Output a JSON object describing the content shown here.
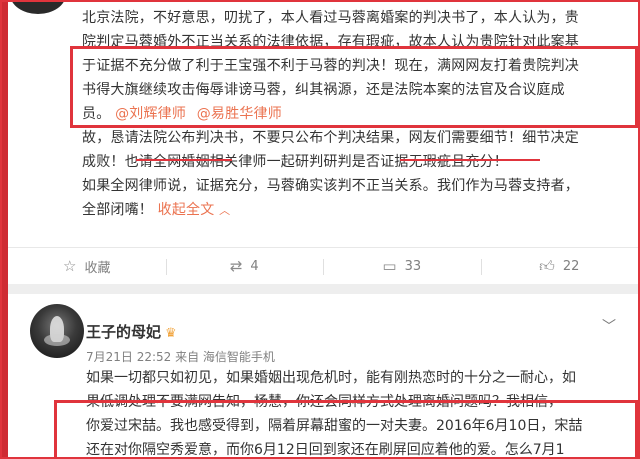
{
  "post1": {
    "lines": [
      "北京法院，不好意思，叨扰了，本人看过马蓉离婚案的判决书了，本人认为，贵",
      "院判定马蓉婚外不正当关系的法律依据，存有瑕疵，故本人认为贵院针对此案基",
      "于证据不充分做了利于王宝强不利于马蓉的判决！现在，满网网友打着贵院判决",
      "书得大旗继续攻击侮辱诽谤马蓉，纠其祸源，还是法院本案的法官及合议庭成"
    ],
    "line5_prefix": "员。",
    "mention1": "@刘辉律师",
    "mention2": "@易胜华律师",
    "line6": "故，恳请法院公布判决书，不要只公布个判决结果，网友们需要细节！细节决定",
    "line7": "成败！也请全网婚姻相关律师一起研判研判是否证据无瑕疵且充分！",
    "line8": "如果全网律师说，证据充分，马蓉确实该判不正当关系。我们作为马蓉支持者，",
    "line9_prefix": "全部闭嘴！",
    "collapse_label": "收起全文",
    "collapse_icon": "chevron-up-icon"
  },
  "actions": {
    "favorite_label": "收藏",
    "repost_count": "4",
    "comment_count": "33",
    "like_count": "22"
  },
  "post2": {
    "author_name": "王子的母妃",
    "meta": "7月21日 22:52 来自 海信智能手机",
    "lines": [
      "如果一切都只如初见，如果婚姻出现危机时，能有刚热恋时的十分之一耐心，如",
      "果低调处理不要满网告知，杨慧，你还会同样方式处理离婚问题吗？我相信，",
      "你爱过宋喆。我也感受得到，隔着屏幕甜蜜的一对夫妻。2016年6月10日，宋喆",
      "还在对你隔空秀爱意，而你6月12日回到家还在刷屏回应着他的爱。怎么7月1"
    ]
  },
  "colors": {
    "highlight_red": "#e0343c",
    "link_orange": "#eb7350",
    "meta_gray": "#808080"
  }
}
